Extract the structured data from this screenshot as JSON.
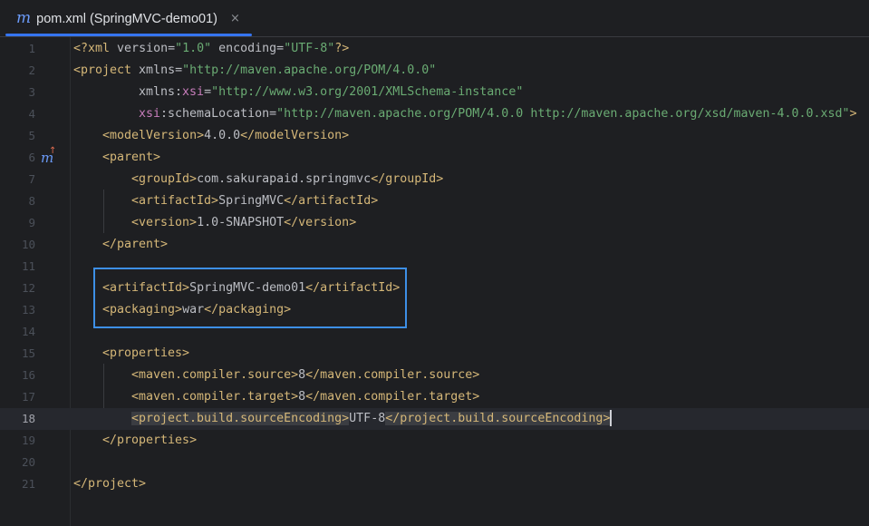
{
  "tab": {
    "icon": "maven-m-icon",
    "icon_glyph": "m",
    "title": "pom.xml (SpringMVC-demo01)",
    "close_glyph": "×"
  },
  "gutter": {
    "line6_marker_glyph": "m",
    "line6_arrow_glyph": "↑"
  },
  "lines": [
    {
      "n": "1"
    },
    {
      "n": "2"
    },
    {
      "n": "3"
    },
    {
      "n": "4"
    },
    {
      "n": "5"
    },
    {
      "n": "6"
    },
    {
      "n": "7"
    },
    {
      "n": "8"
    },
    {
      "n": "9"
    },
    {
      "n": "10"
    },
    {
      "n": "11"
    },
    {
      "n": "12"
    },
    {
      "n": "13"
    },
    {
      "n": "14"
    },
    {
      "n": "15"
    },
    {
      "n": "16"
    },
    {
      "n": "17"
    },
    {
      "n": "18"
    },
    {
      "n": "19"
    },
    {
      "n": "20"
    },
    {
      "n": "21"
    }
  ],
  "code": {
    "l1": {
      "open": "<?xml ",
      "a1": "version=",
      "v1": "\"1.0\"",
      "a2": " encoding=",
      "v2": "\"UTF-8\"",
      "close": "?>"
    },
    "l2": {
      "tag": "<project",
      "a1": " xmlns=",
      "v1": "\"http://maven.apache.org/POM/4.0.0\""
    },
    "l3": {
      "a1": "xmlns:",
      "ns": "xsi",
      "eq": "=",
      "v1": "\"http://www.w3.org/2001/XMLSchema-instance\""
    },
    "l4": {
      "ns": "xsi",
      "a1": ":schemaLocation=",
      "v1": "\"http://maven.apache.org/POM/4.0.0 http://maven.apache.org/xsd/maven-4.0.0.xsd\"",
      "close": ">"
    },
    "l5": {
      "open": "<modelVersion>",
      "text": "4.0.0",
      "close": "</modelVersion>"
    },
    "l6": {
      "open": "<parent>"
    },
    "l7": {
      "open": "<groupId>",
      "text": "com.sakurapaid.springmvc",
      "close": "</groupId>"
    },
    "l8": {
      "open": "<artifactId>",
      "text": "SpringMVC",
      "close": "</artifactId>"
    },
    "l9": {
      "open": "<version>",
      "text": "1.0-SNAPSHOT",
      "close": "</version>"
    },
    "l10": {
      "close": "</parent>"
    },
    "l12": {
      "open": "<artifactId>",
      "text": "SpringMVC-demo01",
      "close": "</artifactId>"
    },
    "l13": {
      "open": "<packaging>",
      "text": "war",
      "close": "</packaging>"
    },
    "l15": {
      "open": "<properties>"
    },
    "l16": {
      "open": "<maven.compiler.source>",
      "text": "8",
      "close": "</maven.compiler.source>"
    },
    "l17": {
      "open": "<maven.compiler.target>",
      "text": "8",
      "close": "</maven.compiler.target>"
    },
    "l18": {
      "open": "<project.build.sourceEncoding>",
      "text": "UTF-8",
      "close": "</project.build.sourceEncoding>"
    },
    "l19": {
      "close": "</properties>"
    },
    "l21": {
      "close": "</project>"
    }
  },
  "colors": {
    "tag": "#d5b778",
    "string": "#6aab73",
    "namespace": "#c77dbb",
    "highlight_box": "#3d8fe6",
    "tab_underline": "#3574f0"
  }
}
